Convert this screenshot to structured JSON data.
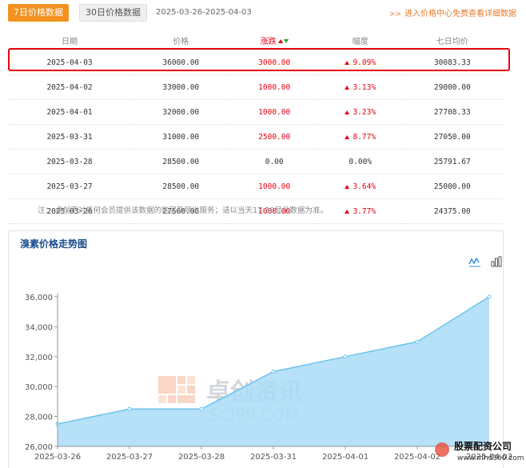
{
  "toolbar": {
    "tab_7day": "7日价格数据",
    "tab_30day": "30日价格数据",
    "date_range": "2025-03-26-2025-04-03",
    "link_text": "进入价格中心免费查看详细数据"
  },
  "table": {
    "headers": [
      "日期",
      "价格",
      "涨跌",
      "幅度",
      "七日均价"
    ],
    "rows": [
      {
        "date": "2025-04-03",
        "price": "36000.00",
        "change": "3000.00",
        "pct": "9.09%",
        "avg": "30083.33",
        "dir": "up"
      },
      {
        "date": "2025-04-02",
        "price": "33000.00",
        "change": "1000.00",
        "pct": "3.13%",
        "avg": "29000.00",
        "dir": "up"
      },
      {
        "date": "2025-04-01",
        "price": "32000.00",
        "change": "1000.00",
        "pct": "3.23%",
        "avg": "27708.33",
        "dir": "up"
      },
      {
        "date": "2025-03-31",
        "price": "31000.00",
        "change": "2500.00",
        "pct": "8.77%",
        "avg": "27050.00",
        "dir": "up"
      },
      {
        "date": "2025-03-28",
        "price": "28500.00",
        "change": "0.00",
        "pct": "0.00%",
        "avg": "25791.67",
        "dir": "flat"
      },
      {
        "date": "2025-03-27",
        "price": "28500.00",
        "change": "1000.00",
        "pct": "3.64%",
        "avg": "25000.00",
        "dir": "up"
      },
      {
        "date": "2025-03-26",
        "price": "27500.00",
        "change": "1000.00",
        "pct": "3.77%",
        "avg": "24375.00",
        "dir": "up"
      }
    ],
    "note": "注：  卓创不对任何会员提供该数据的购买及导出服务；请以当天17:30显示数据为准。"
  },
  "chart_panel": {
    "title": "溴素价格走势图",
    "watermark_cn": "卓创资讯",
    "watermark_en": "SCI99.COM",
    "corner_logo": "股票配资公司",
    "corner_url": "www.mhd360.com"
  },
  "colors": {
    "accent": "#f39121",
    "up": "#e60012",
    "fill": "#a9dcf7",
    "line": "#6cc3ef",
    "title": "#1a4b8c"
  },
  "chart_data": {
    "type": "area",
    "x": [
      "2025-03-26",
      "2025-03-27",
      "2025-03-28",
      "2025-03-31",
      "2025-04-01",
      "2025-04-02",
      "2025-04-03"
    ],
    "values": [
      27500,
      28500,
      28500,
      31000,
      32000,
      33000,
      36000
    ],
    "yticks": [
      "26,000",
      "28,000",
      "30,000",
      "32,000",
      "34,000",
      "36,000"
    ],
    "ylim": [
      26000,
      36000
    ],
    "grid": false
  }
}
